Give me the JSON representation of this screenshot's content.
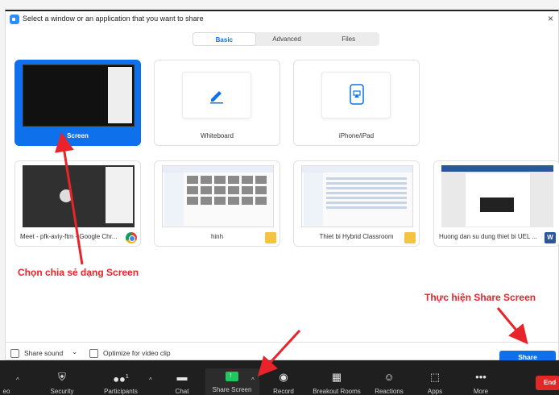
{
  "dialog": {
    "title": "Select a window or an application that you want to share",
    "close_glyph": "×"
  },
  "tabs": [
    {
      "label": "Basic",
      "active": true
    },
    {
      "label": "Advanced",
      "active": false
    },
    {
      "label": "Files",
      "active": false
    }
  ],
  "cards": [
    {
      "label": "Screen",
      "selected": true
    },
    {
      "label": "Whiteboard",
      "icon": "pen-icon"
    },
    {
      "label": "iPhone/iPad",
      "icon": "airplay-icon"
    },
    {
      "label": "Meet - pfk-aviy-ftm - Google Chr...",
      "app_icon": "chrome-icon"
    },
    {
      "label": "hinh",
      "app_icon": "folder-icon"
    },
    {
      "label": "Thiet bi Hybrid Classroom",
      "app_icon": "folder-icon"
    },
    {
      "label": "Huong dan su dung thiet bi UEL ...",
      "app_icon": "word-icon",
      "app_icon_text": "W"
    }
  ],
  "annotations": {
    "choose_screen": "Chọn chia sẻ dạng Screen",
    "do_share": "Thực hiện Share Screen",
    "color": "#e8232a"
  },
  "footer": {
    "share_sound": "Share sound",
    "share_sound_caret": "⌄",
    "optimize_video": "Optimize for video clip",
    "share_button": "Share"
  },
  "toolbar": {
    "items": [
      {
        "label": "eo",
        "icon": "video-icon"
      },
      {
        "label": "Security",
        "icon": "shield-icon"
      },
      {
        "label": "Participants",
        "icon": "participants-icon",
        "count": "1"
      },
      {
        "label": "Chat",
        "icon": "chat-icon"
      },
      {
        "label": "Share Screen",
        "icon": "share-screen-icon"
      },
      {
        "label": "Record",
        "icon": "record-icon"
      },
      {
        "label": "Breakout Rooms",
        "icon": "breakout-rooms-icon"
      },
      {
        "label": "Reactions",
        "icon": "reactions-icon"
      },
      {
        "label": "Apps",
        "icon": "apps-icon"
      },
      {
        "label": "More",
        "icon": "more-icon"
      }
    ],
    "caret": "^",
    "end_label": "End"
  },
  "colors": {
    "accent": "#0e71eb",
    "toolbar_bg": "#1f1f1f",
    "share_green": "#22c55e",
    "end_red": "#e02828"
  }
}
